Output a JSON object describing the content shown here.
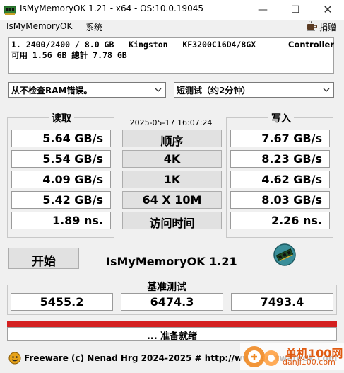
{
  "window": {
    "title": "IsMyMemoryOK 1.21 - x64 - OS:10.0.19045",
    "minimize_glyph": "—",
    "maximize_glyph": "☐",
    "close_glyph": "✕"
  },
  "menu": {
    "app": "IsMyMemoryOK",
    "system": "系统",
    "donate": "捐赠",
    "donate_icon": "coffee-cup-icon"
  },
  "memory_info": {
    "line1": "1. 2400/2400 / 8.0 GB   Kingston   KF3200C16D4/8GX",
    "line2": "可用 1.56 GB 總計 7.78 GB",
    "controller": "Controller"
  },
  "options": {
    "ram_error_mode": "从不检查RAM错误。",
    "test_duration": "短测试（约2分钟）"
  },
  "results": {
    "timestamp": "2025-05-17 16:07:24",
    "read_label": "读取",
    "write_label": "写入",
    "rows": [
      {
        "name": "顺序",
        "read": "5.64 GB/s",
        "write": "7.67 GB/s"
      },
      {
        "name": "4K",
        "read": "5.54 GB/s",
        "write": "8.23 GB/s"
      },
      {
        "name": "1K",
        "read": "4.09 GB/s",
        "write": "4.62 GB/s"
      },
      {
        "name": "64 X 10M",
        "read": "5.42 GB/s",
        "write": "8.03 GB/s"
      },
      {
        "name": "访问时间",
        "read": "1.89 ns.",
        "write": "2.26 ns."
      }
    ]
  },
  "start_label": "开始",
  "brand_title": "IsMyMemoryOK 1.21",
  "benchmark": {
    "label": "基准测试",
    "scores": [
      "5455.2",
      "6474.3",
      "7493.4"
    ]
  },
  "progress": {
    "fraction": 1.0,
    "color": "#d42020"
  },
  "status": "... 准备就绪",
  "footer": "Freeware (c) Nenad Hrg 2024-2025 # http://www.softwareok.com",
  "watermark": {
    "line1": "单机100网",
    "line2": "danji100.com"
  },
  "colors": {
    "window_bg": "#f0f0f0",
    "progress": "#d42020",
    "watermark": "#e05a10"
  }
}
